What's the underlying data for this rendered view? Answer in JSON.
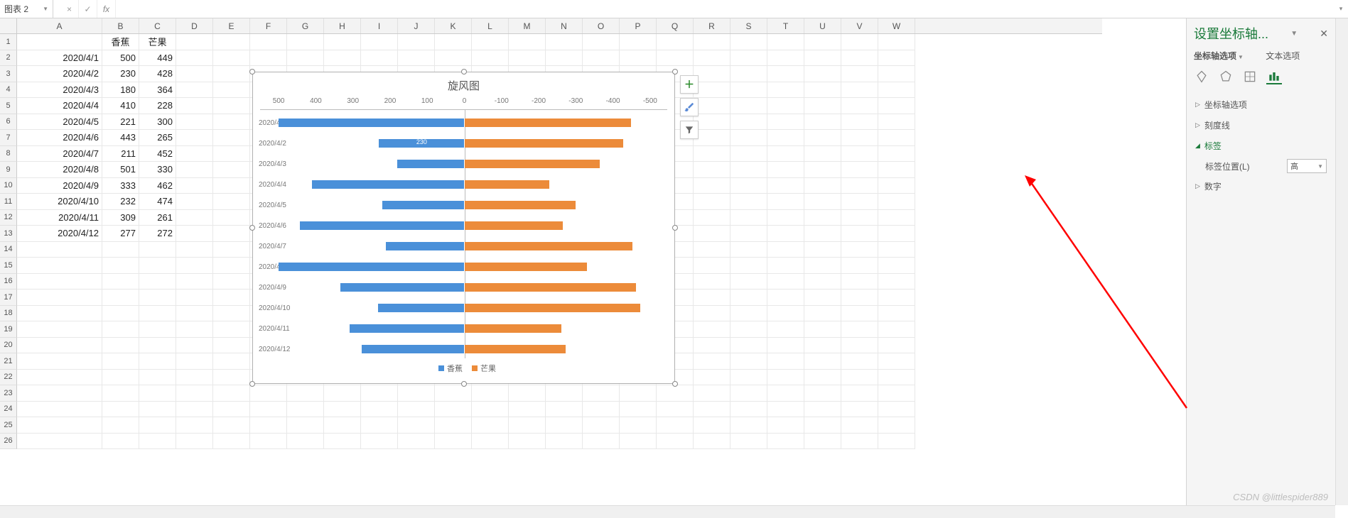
{
  "nameBox": "图表 2",
  "formulaButtons": {
    "cancel": "×",
    "confirm": "✓",
    "fx": "fx"
  },
  "columns": [
    "A",
    "B",
    "C",
    "D",
    "E",
    "F",
    "G",
    "H",
    "I",
    "J",
    "K",
    "L",
    "M",
    "N",
    "O",
    "P",
    "Q",
    "R",
    "S",
    "T",
    "U",
    "V",
    "W"
  ],
  "table": {
    "headers": {
      "banana": "香蕉",
      "mango": "芒果"
    },
    "rows": [
      {
        "date": "2020/4/1",
        "banana": 500,
        "mango": 449
      },
      {
        "date": "2020/4/2",
        "banana": 230,
        "mango": 428
      },
      {
        "date": "2020/4/3",
        "banana": 180,
        "mango": 364
      },
      {
        "date": "2020/4/4",
        "banana": 410,
        "mango": 228
      },
      {
        "date": "2020/4/5",
        "banana": 221,
        "mango": 300
      },
      {
        "date": "2020/4/6",
        "banana": 443,
        "mango": 265
      },
      {
        "date": "2020/4/7",
        "banana": 211,
        "mango": 452
      },
      {
        "date": "2020/4/8",
        "banana": 501,
        "mango": 330
      },
      {
        "date": "2020/4/9",
        "banana": 333,
        "mango": 462
      },
      {
        "date": "2020/4/10",
        "banana": 232,
        "mango": 474
      },
      {
        "date": "2020/4/11",
        "banana": 309,
        "mango": 261
      },
      {
        "date": "2020/4/12",
        "banana": 277,
        "mango": 272
      }
    ]
  },
  "chart_data": {
    "type": "bar",
    "title": "旋风图",
    "orientation": "horizontal-diverging",
    "categories": [
      "2020/4/1",
      "2020/4/2",
      "2020/4/3",
      "2020/4/4",
      "2020/4/5",
      "2020/4/6",
      "2020/4/7",
      "2020/4/8",
      "2020/4/9",
      "2020/4/10",
      "2020/4/11",
      "2020/4/12"
    ],
    "series": [
      {
        "name": "香蕉",
        "color": "#4a90d9",
        "values": [
          500,
          230,
          180,
          410,
          221,
          443,
          211,
          501,
          333,
          232,
          309,
          277
        ]
      },
      {
        "name": "芒果",
        "color": "#ec8b3a",
        "values": [
          -449,
          -428,
          -364,
          -228,
          -300,
          -265,
          -452,
          -330,
          -462,
          -474,
          -261,
          -272
        ]
      }
    ],
    "x_ticks": [
      500,
      400,
      300,
      200,
      100,
      0,
      -100,
      -200,
      -300,
      -400,
      -500
    ],
    "xlim": [
      -550,
      550
    ],
    "data_labels": [
      {
        "series": "香蕉",
        "category": "2020/4/2",
        "value": 230
      }
    ],
    "legend": [
      "香蕉",
      "芒果"
    ],
    "axis_position": "top",
    "category_label_position": "high"
  },
  "chartButtons": {
    "plus": "+",
    "brush": "paint",
    "filter": "filter"
  },
  "sidePanel": {
    "title": "设置坐标轴...",
    "tabs": {
      "axisOptions": "坐标轴选项",
      "textOptions": "文本选项"
    },
    "sections": {
      "axisOptions": "坐标轴选项",
      "tickMarks": "刻度线",
      "labels": "标签",
      "numbers": "数字"
    },
    "labelField": {
      "label": "标签位置(L)",
      "value": "高"
    }
  },
  "watermark": "CSDN @littlespider889"
}
